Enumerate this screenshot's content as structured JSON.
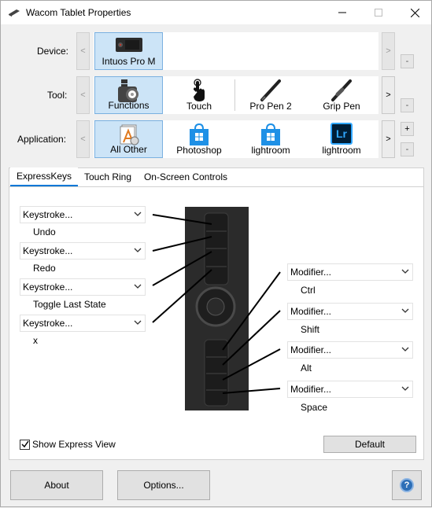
{
  "window": {
    "title": "Wacom Tablet Properties"
  },
  "rows": {
    "device": {
      "label": "Device:",
      "items": [
        {
          "label": "Intuos Pro M",
          "icon": "tablet-icon"
        }
      ]
    },
    "tool": {
      "label": "Tool:",
      "items": [
        {
          "label": "Functions",
          "icon": "functions-icon"
        },
        {
          "label": "Touch",
          "icon": "touch-hand-icon"
        },
        {
          "label": "Pro Pen 2",
          "icon": "pen-icon"
        },
        {
          "label": "Grip Pen",
          "icon": "pen-icon"
        }
      ]
    },
    "application": {
      "label": "Application:",
      "items": [
        {
          "label": "All Other",
          "icon": "all-other-apps-icon"
        },
        {
          "label": "Photoshop",
          "icon": "store-bag-icon"
        },
        {
          "label": "lightroom",
          "icon": "store-bag-icon"
        },
        {
          "label": "lightroom",
          "icon": "lightroom-icon"
        }
      ]
    }
  },
  "scroll": {
    "left": "<",
    "right": ">",
    "minus": "-",
    "plus": "+"
  },
  "lightroom_logo_text": "Lr",
  "tabs": [
    "ExpressKeys",
    "Touch Ring",
    "On-Screen Controls"
  ],
  "left_keys": [
    {
      "dropdown": "Keystroke...",
      "label": "Undo"
    },
    {
      "dropdown": "Keystroke...",
      "label": "Redo"
    },
    {
      "dropdown": "Keystroke...",
      "label": "Toggle Last State"
    },
    {
      "dropdown": "Keystroke...",
      "label": "x"
    }
  ],
  "right_keys": [
    {
      "dropdown": "Modifier...",
      "label": "Ctrl"
    },
    {
      "dropdown": "Modifier...",
      "label": "Shift"
    },
    {
      "dropdown": "Modifier...",
      "label": "Alt"
    },
    {
      "dropdown": "Modifier...",
      "label": "Space"
    }
  ],
  "show_express_view": {
    "label": "Show Express View",
    "checked": true
  },
  "buttons": {
    "default": "Default",
    "about": "About",
    "options": "Options...",
    "help": "?"
  },
  "colors": {
    "accent": "#0078d7",
    "selection": "#cce4f7",
    "tablet": "#2b2b2b",
    "lightroom_bg": "#001e36",
    "lightroom_fg": "#31a8ff",
    "store_blue": "#1e90e6"
  }
}
